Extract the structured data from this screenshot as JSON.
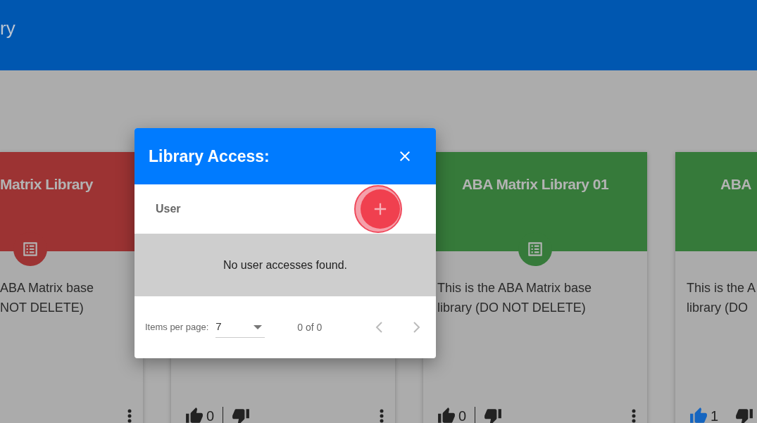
{
  "header": {
    "title": "ry"
  },
  "cards": [
    {
      "kind": "cut_left",
      "title": "Matrix Library",
      "color": "#9c3333",
      "description": [
        "ABA Matrix base",
        "NOT DELETE)"
      ]
    },
    {
      "kind": "full",
      "likes": "0",
      "liked": false
    },
    {
      "kind": "full",
      "title": "ABA Matrix Library 01",
      "color": "#367a3a",
      "description": [
        "This is the ABA Matrix base",
        "library (DO NOT DELETE)"
      ],
      "likes": "0",
      "liked": false
    },
    {
      "kind": "cut_right",
      "title": "ABA",
      "color": "#367a3a",
      "description": [
        "This is the A",
        "library (DO"
      ],
      "likes": "1",
      "liked": true
    }
  ],
  "dialog": {
    "title": "Library Access:",
    "column": "User",
    "empty_message": "No user accesses found.",
    "paginator": {
      "label": "Items per page:",
      "page_size": "7",
      "range": "0 of 0",
      "prev_disabled": true,
      "next_disabled": true
    }
  }
}
